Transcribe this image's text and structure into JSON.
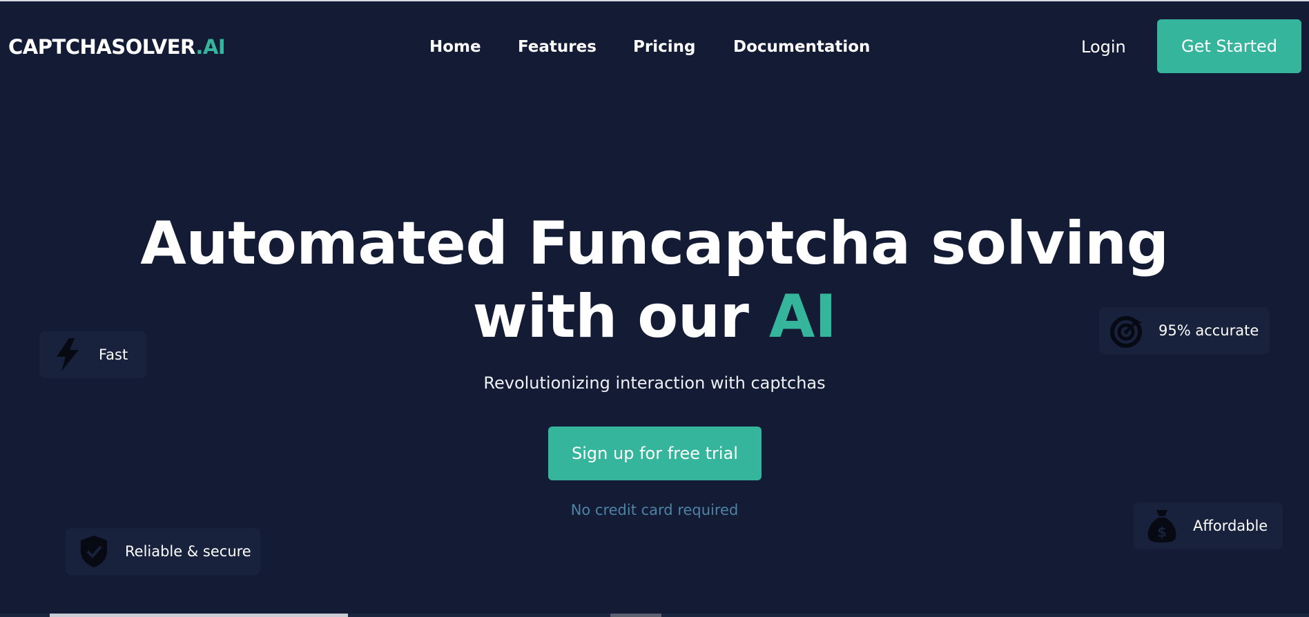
{
  "header": {
    "logo_main": "CAPTCHASOLVER",
    "logo_accent": ".AI",
    "nav": [
      "Home",
      "Features",
      "Pricing",
      "Documentation"
    ],
    "login": "Login",
    "cta": "Get Started"
  },
  "hero": {
    "title_line1": "Automated Funcaptcha solving",
    "title_line2_prefix": "with our ",
    "title_line2_accent": "AI",
    "subtitle": "Revolutionizing interaction with captchas",
    "cta": "Sign up for free trial",
    "note": "No credit card required"
  },
  "badges": {
    "fast": {
      "label": "Fast",
      "icon": "lightning-icon"
    },
    "accurate": {
      "label": "95% accurate",
      "icon": "target-icon"
    },
    "secure": {
      "label": "Reliable & secure",
      "icon": "shield-check-icon"
    },
    "affordable": {
      "label": "Affordable",
      "icon": "money-bag-icon"
    }
  },
  "colors": {
    "background": "#141c35",
    "accent": "#35b59c",
    "badge_bg": "#18223d",
    "note": "#4d83a3"
  }
}
